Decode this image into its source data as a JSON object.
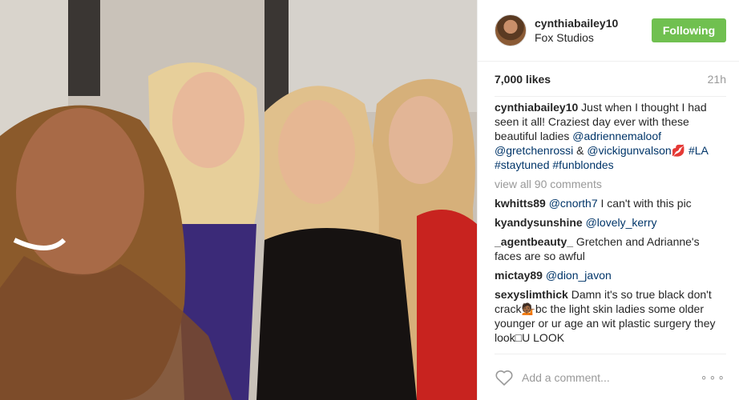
{
  "post": {
    "username": "cynthiabailey10",
    "location": "Fox Studios",
    "follow_label": "Following",
    "follow_color": "#70c050",
    "likes": "7,000 likes",
    "time_ago": "21h",
    "caption": {
      "user": "cynthiabailey10",
      "text_1": " Just when I thought I had seen it all! Craziest day ever with these beautiful ladies ",
      "mention_1": "@adriennemaloof",
      "mention_2": "@gretchenrossi",
      "amp": " & ",
      "mention_3": "@vickigunvalson",
      "emoji": "💋",
      "tag_1": "#LA",
      "tag_2": "#staytuned",
      "tag_3": "#funblondes"
    },
    "view_all": "view all 90 comments",
    "comments": [
      {
        "user": "kwhitts89",
        "mention": "@cnorth7",
        "text": " I can't with this pic"
      },
      {
        "user": "kyandysunshine",
        "mention": "@lovely_kerry",
        "text": ""
      },
      {
        "user": "_agentbeauty_",
        "mention": "",
        "text": " Gretchen and Adrianne's faces are so awful"
      },
      {
        "user": "mictay89",
        "mention": "@dion_javon",
        "text": ""
      },
      {
        "user": "sexyslimthick",
        "mention": "",
        "text": " Damn it's so true black don't crack💁🏾bc the light skin ladies some older younger or ur age an wit plastic surgery they look□U LOOK"
      }
    ],
    "add_comment_placeholder": "Add a comment...",
    "more_glyph": "∘∘∘",
    "heart_icon": "heart-outline-icon"
  }
}
